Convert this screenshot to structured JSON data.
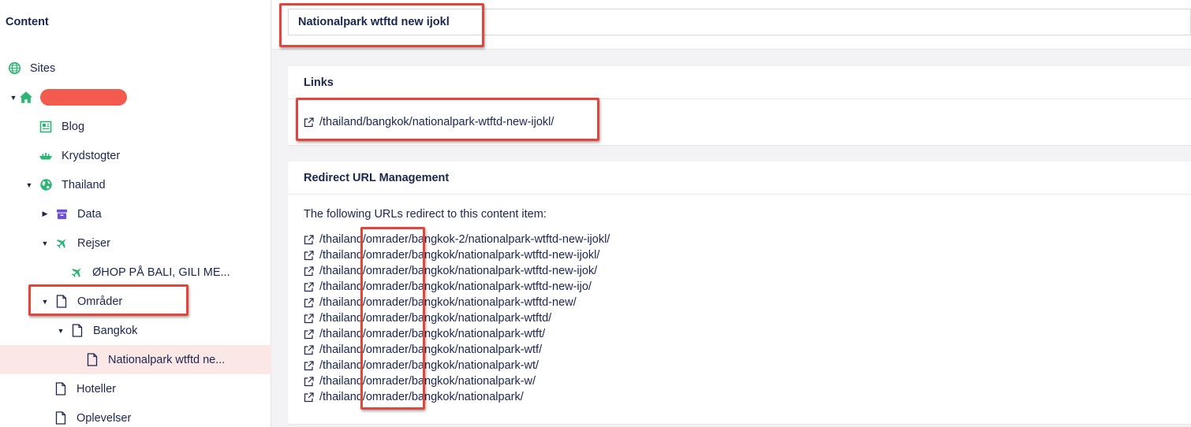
{
  "sidebar": {
    "title": "Content",
    "items": [
      {
        "label": "Sites",
        "icon": "globe-icon"
      },
      {
        "label": "",
        "icon": "home-icon"
      },
      {
        "label": "Blog",
        "icon": "newspaper-icon"
      },
      {
        "label": "Krydstogter",
        "icon": "ship-icon"
      },
      {
        "label": "Thailand",
        "icon": "earth-icon"
      },
      {
        "label": "Data",
        "icon": "box-icon"
      },
      {
        "label": "Rejser",
        "icon": "plane-icon"
      },
      {
        "label": "ØHOP PÅ BALI, GILI ME...",
        "icon": "plane-icon"
      },
      {
        "label": "Områder",
        "icon": "document-icon"
      },
      {
        "label": "Bangkok",
        "icon": "document-icon"
      },
      {
        "label": "Nationalpark wtftd ne...",
        "icon": "document-icon"
      },
      {
        "label": "Hoteller",
        "icon": "document-icon"
      },
      {
        "label": "Oplevelser",
        "icon": "document-icon"
      }
    ]
  },
  "header": {
    "name_value": "Nationalpark wtftd new ijokl"
  },
  "links_panel": {
    "title": "Links",
    "url": "/thailand/bangkok/nationalpark-wtftd-new-ijokl/"
  },
  "redirect_panel": {
    "title": "Redirect URL Management",
    "intro": "The following URLs redirect to this content item:",
    "urls": [
      "/thailand/omrader/bangkok-2/nationalpark-wtftd-new-ijokl/",
      "/thailand/omrader/bangkok/nationalpark-wtftd-new-ijokl/",
      "/thailand/omrader/bangkok/nationalpark-wtftd-new-ijok/",
      "/thailand/omrader/bangkok/nationalpark-wtftd-new-ijo/",
      "/thailand/omrader/bangkok/nationalpark-wtftd-new/",
      "/thailand/omrader/bangkok/nationalpark-wtftd/",
      "/thailand/omrader/bangkok/nationalpark-wtft/",
      "/thailand/omrader/bangkok/nationalpark-wtf/",
      "/thailand/omrader/bangkok/nationalpark-wt/",
      "/thailand/omrader/bangkok/nationalpark-w/",
      "/thailand/omrader/bangkok/nationalpark/"
    ]
  },
  "colors": {
    "highlight": "#e0463c",
    "icon_green": "#2bb673",
    "icon_purple": "#6e4ed8",
    "active_row": "#fbe8e6",
    "text": "#1b264f"
  }
}
